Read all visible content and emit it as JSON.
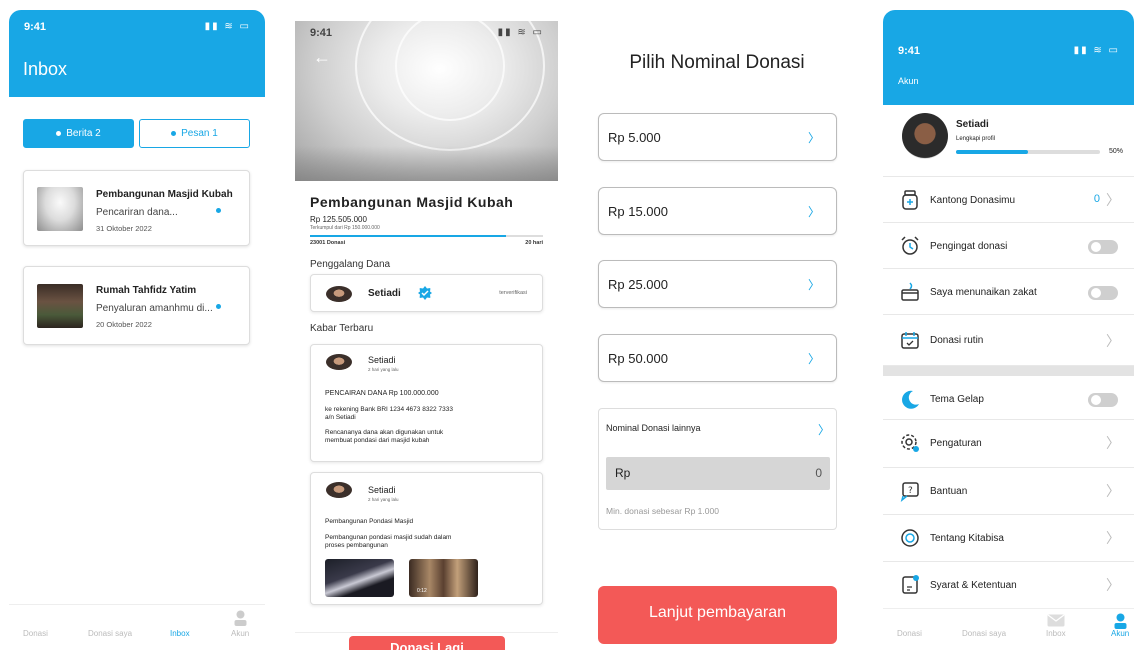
{
  "status": {
    "time": "9:41",
    "icons": "▮▮ ≋ ▭"
  },
  "inbox": {
    "title": "Inbox",
    "tabs": [
      {
        "label": "Berita 2"
      },
      {
        "label": "Pesan 1"
      }
    ],
    "messages": [
      {
        "title": "Pembangunan Masjid Kubah",
        "snippet": "Pencariran dana...",
        "date": "31 Oktober 2022"
      },
      {
        "title": "Rumah Tahfidz Yatim",
        "snippet": "Penyaluran amanhmu di...",
        "date": "20 Oktober 2022"
      }
    ],
    "nav": [
      "Donasi",
      "Donasi saya",
      "Inbox",
      "Akun"
    ]
  },
  "campaign": {
    "back": "←",
    "title": "Pembangunan Masjid Kubah",
    "amount": "Rp 125.505.000",
    "collected": "Terkumpul dari Rp 150.000.000",
    "progress": 0.84,
    "donations": "23001 Donasi",
    "days": "20 hari",
    "fundraiser_heading": "Penggalang Dana",
    "fundraiser_name": "Setiadi",
    "verified": "terverifikasi",
    "updates_heading": "Kabar Terbaru",
    "updates": [
      {
        "name": "Setiadi",
        "time": "2 hari yang lalu",
        "headline": "PENCAIRAN DANA Rp 100.000.000",
        "line1": "ke rekening Bank BRI 1234 4673 8322 7333",
        "line2": "a/n Setiadi",
        "line3": "Rencananya dana akan digunakan untuk",
        "line4": "membuat pondasi dari masjid kubah"
      },
      {
        "name": "Setiadi",
        "time": "2 hari yang lalu",
        "headline": "Pembangunan Pondasi Masjid",
        "line1": "Pembangunan pondasi masjid sudah dalam",
        "line2": "proses pembangunan",
        "video_time": "0:12"
      }
    ],
    "cta": "Donasi Lagi"
  },
  "nominal": {
    "title": "Pilih Nominal Donasi",
    "options": [
      "Rp 5.000",
      "Rp 15.000",
      "Rp 25.000",
      "Rp 50.000"
    ],
    "other_label": "Nominal Donasi lainnya",
    "currency": "Rp",
    "value": "0",
    "hint": "Min. donasi sebesar Rp 1.000",
    "cta": "Lanjut pembayaran"
  },
  "account": {
    "title": "Akun",
    "name": "Setiadi",
    "complete": "Lengkapi profil",
    "progress": 0.5,
    "progress_label": "50%",
    "menu": [
      {
        "label": "Kantong Donasimu",
        "value": "0"
      },
      {
        "label": "Pengingat donasi"
      },
      {
        "label": "Saya menunaikan zakat"
      },
      {
        "label": "Donasi rutin"
      },
      {
        "label": "Tema Gelap"
      },
      {
        "label": "Pengaturan"
      },
      {
        "label": "Bantuan"
      },
      {
        "label": "Tentang Kitabisa"
      },
      {
        "label": "Syarat & Ketentuan"
      }
    ],
    "nav": [
      "Donasi",
      "Donasi saya",
      "Inbox",
      "Akun"
    ]
  },
  "colors": {
    "primary": "#18A7E5",
    "cta": "#F35957"
  }
}
